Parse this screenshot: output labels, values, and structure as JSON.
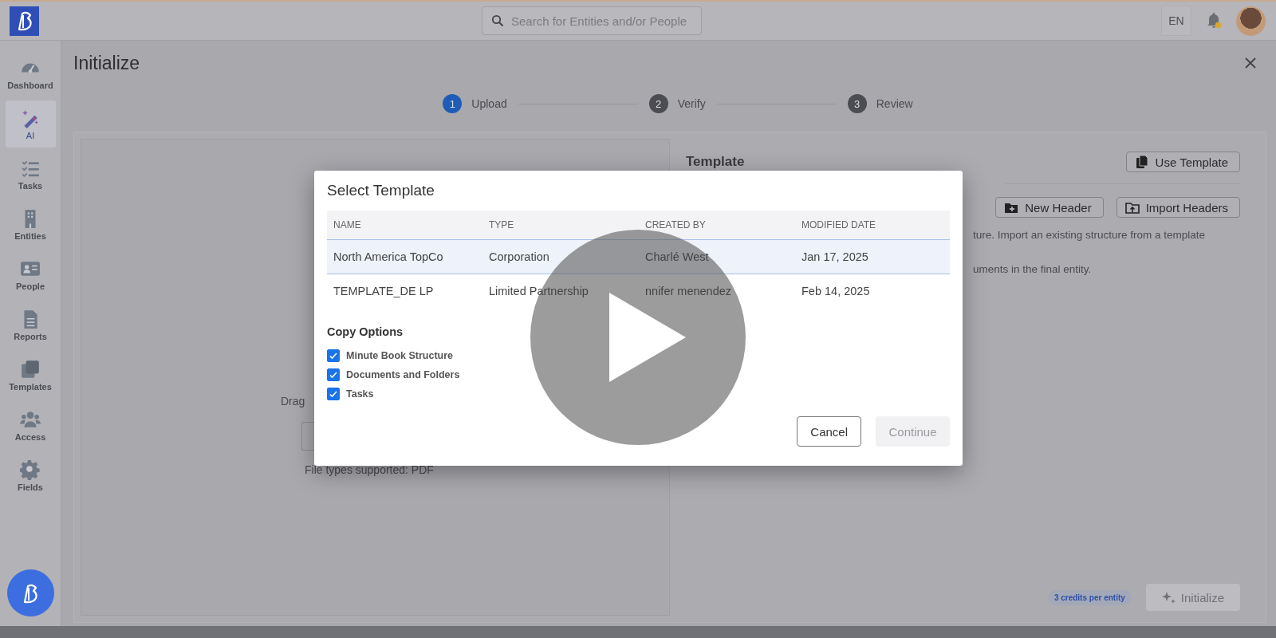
{
  "topbar": {
    "search": {
      "placeholder": "Search for Entities and/or People"
    },
    "language": "EN"
  },
  "sidebar": {
    "items": [
      {
        "label": "Dashboard",
        "kind": "gauge",
        "selected": false
      },
      {
        "label": "AI",
        "kind": "wand",
        "selected": true
      },
      {
        "label": "Tasks",
        "kind": "checklist",
        "selected": false
      },
      {
        "label": "Entities",
        "kind": "building",
        "selected": false
      },
      {
        "label": "People",
        "kind": "card",
        "selected": false
      },
      {
        "label": "Reports",
        "kind": "document",
        "selected": false
      },
      {
        "label": "Templates",
        "kind": "stack",
        "selected": false
      },
      {
        "label": "Access",
        "kind": "group",
        "selected": false
      },
      {
        "label": "Fields",
        "kind": "gear",
        "selected": false
      }
    ]
  },
  "page": {
    "title": "Initialize"
  },
  "stepper": [
    {
      "number": "1",
      "label": "Upload",
      "selected": true
    },
    {
      "number": "2",
      "label": "Verify",
      "selected": false
    },
    {
      "number": "3",
      "label": "Review",
      "selected": false
    }
  ],
  "upload_panel": {
    "drag_text": "Drag",
    "supported_types": "File types supported: PDF"
  },
  "template_panel": {
    "title": "Template",
    "use_template_button": "Use Template",
    "new_header_button": "New Header",
    "import_headers_button": "Import Headers",
    "description": [
      "ture. Import an existing structure from a template",
      "uments in the final entity."
    ],
    "credits_badge": "3 credits per entity",
    "initialize_button": {
      "label": "Initialize",
      "disabled": true
    }
  },
  "dialog": {
    "title": "Select Template",
    "table": {
      "columns": [
        "NAME",
        "TYPE",
        "CREATED BY",
        "MODIFIED DATE"
      ],
      "rows": [
        {
          "cells": [
            "North America TopCo",
            "Corporation",
            "Charlé West",
            "Jan 17, 2025"
          ],
          "selected": true
        },
        {
          "cells": [
            "TEMPLATE_DE LP",
            "Limited Partnership",
            "nnifer menendez",
            "Feb 14, 2025"
          ],
          "selected": false
        }
      ]
    },
    "copy_options": {
      "title": "Copy Options",
      "options": [
        {
          "label": "Minute Book Structure",
          "checked": true
        },
        {
          "label": "Documents and Folders",
          "checked": true
        },
        {
          "label": "Tasks",
          "checked": true
        }
      ]
    },
    "buttons": [
      {
        "label": "Cancel",
        "kind": "outline",
        "disabled": false
      },
      {
        "label": "Continue",
        "kind": "primary",
        "disabled": true
      }
    ]
  }
}
